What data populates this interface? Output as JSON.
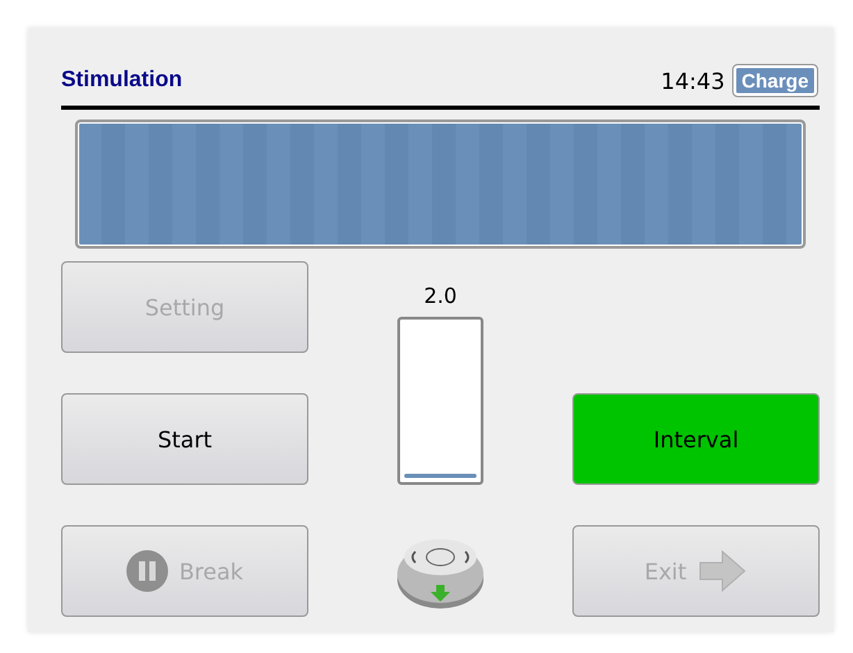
{
  "header": {
    "title": "Stimulation",
    "time": "14:43",
    "charge_button": "Charge"
  },
  "buttons": [
    {
      "label": "Setting",
      "disabled": true,
      "kind": "plain"
    },
    {
      "label": "Start",
      "disabled": false,
      "kind": "plain"
    },
    {
      "label": "Break",
      "disabled": true,
      "kind": "pause"
    }
  ],
  "meter": {
    "reading": "2.0",
    "level": 0.03
  },
  "interval": {
    "label": "Interval",
    "on": true
  },
  "exit": {
    "label": "Exit",
    "disabled": true
  }
}
